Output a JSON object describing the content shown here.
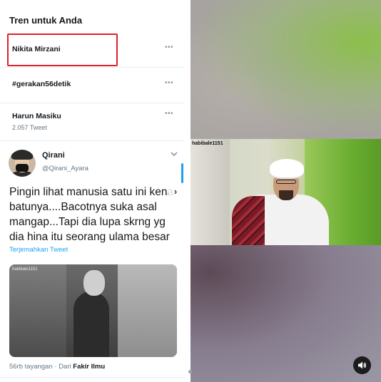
{
  "trends": {
    "header": "Tren untuk Anda",
    "items": [
      {
        "name": "Nikita Mirzani",
        "count": "",
        "more": "•••"
      },
      {
        "name": "#gerakan56detik",
        "count": "",
        "more": "•••"
      },
      {
        "name": "Harun Masiku",
        "count": "2.057 Tweet",
        "more": "•••"
      }
    ]
  },
  "tweet": {
    "name": "Qirani",
    "handle": "@Qirani_Ayara",
    "text": "Pingin lihat manusia satu ini kena batunya....Bacotnya suka asal mangap...Tapi dia lupa skrng yg dia hina itu seorang ulama besar",
    "translate": "Terjemahkan Tweet",
    "media_watermark": "habibale1151",
    "views": "56rb tayangan",
    "from_prefix": "· Dari",
    "from_source": "Fakir Ilmu"
  },
  "video": {
    "watermark": "habibale1151",
    "next_glyph": "›"
  },
  "icons": {
    "tweet_menu": "chevron-down-icon",
    "next": "chevron-right-icon",
    "sound": "speaker-icon"
  },
  "colors": {
    "highlight": "#e0202a",
    "link": "#1da1f2"
  }
}
